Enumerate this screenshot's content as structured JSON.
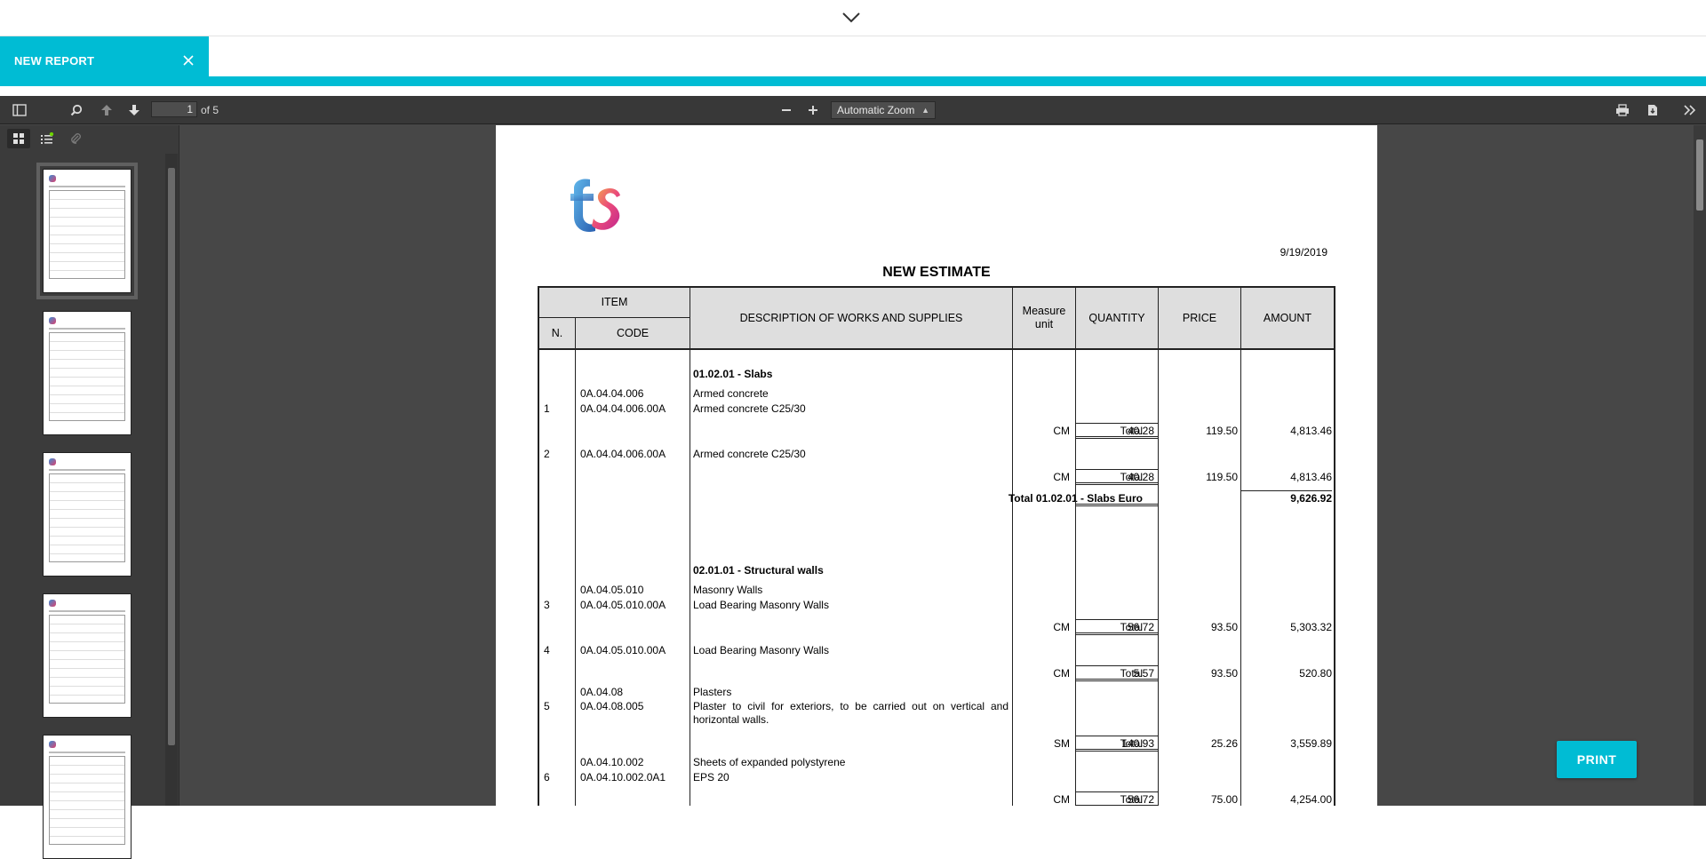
{
  "app": {
    "tab_title": "NEW REPORT",
    "accent_color": "#00bcd4"
  },
  "toolbar": {
    "current_page": "1",
    "page_of": "of 5",
    "zoom_label": "Automatic Zoom",
    "icons": [
      "sidebar-toggle-icon",
      "search-icon",
      "previous-page-icon",
      "next-page-icon",
      "zoom-out-icon",
      "zoom-in-icon",
      "print-icon",
      "download-icon",
      "tools-icon"
    ]
  },
  "sidebar": {
    "thumbnail_count": 5
  },
  "document": {
    "date": "9/19/2019",
    "title": "NEW ESTIMATE",
    "headers": {
      "item": "ITEM",
      "n": "N.",
      "code": "CODE",
      "description": "DESCRIPTION OF WORKS AND SUPPLIES",
      "measure_unit": "Measure unit",
      "quantity": "QUANTITY",
      "price": "PRICE",
      "amount": "AMOUNT"
    },
    "sections": {
      "s1_title": "01.02.01 - Slabs",
      "s1_code_a": "0A.04.04.006",
      "s1_desc_a": "Armed concrete",
      "r1_n": "1",
      "r1_code": "0A.04.04.006.00A",
      "r1_desc": "Armed concrete C25/30",
      "r1_total": "Total",
      "r1_unit": "CM",
      "r1_qty": "40.28",
      "r1_price": "119.50",
      "r1_amount": "4,813.46",
      "r2_n": "2",
      "r2_code": "0A.04.04.006.00A",
      "r2_desc": "Armed concrete C25/30",
      "r2_total": "Total",
      "r2_unit": "CM",
      "r2_qty": "40.28",
      "r2_price": "119.50",
      "r2_amount": "4,813.46",
      "s1_total_label": "Total 01.02.01 - Slabs Euro",
      "s1_total_amount": "9,626.92",
      "s2_title": "02.01.01 - Structural walls",
      "s2_code_a": "0A.04.05.010",
      "s2_desc_a": "Masonry Walls",
      "r3_n": "3",
      "r3_code": "0A.04.05.010.00A",
      "r3_desc": "Load Bearing Masonry Walls",
      "r3_total": "Total",
      "r3_unit": "CM",
      "r3_qty": "56.72",
      "r3_price": "93.50",
      "r3_amount": "5,303.32",
      "r4_n": "4",
      "r4_code": "0A.04.05.010.00A",
      "r4_desc": "Load Bearing Masonry Walls",
      "r4_total": "Total",
      "r4_unit": "CM",
      "r4_qty": "5.57",
      "r4_price": "93.50",
      "r4_amount": "520.80",
      "r5_code_a": "0A.04.08",
      "r5_desc_a": "Plasters",
      "r5_n": "5",
      "r5_code": "0A.04.08.005",
      "r5_desc_l1": "Plaster to civil for exteriors, to be carried out on vertical and",
      "r5_desc_l2": "horizontal walls.",
      "r5_total": "Total",
      "r5_unit": "SM",
      "r5_qty": "140.93",
      "r5_price": "25.26",
      "r5_amount": "3,559.89",
      "r6_code_a": "0A.04.10.002",
      "r6_desc_a": "Sheets of expanded polystyrene",
      "r6_n": "6",
      "r6_code": "0A.04.10.002.0A1",
      "r6_desc": "EPS 20",
      "r6_total": "Total",
      "r6_unit": "CM",
      "r6_qty": "56.72",
      "r6_price": "75.00",
      "r6_amount": "4,254.00"
    }
  },
  "print_button": "PRINT"
}
